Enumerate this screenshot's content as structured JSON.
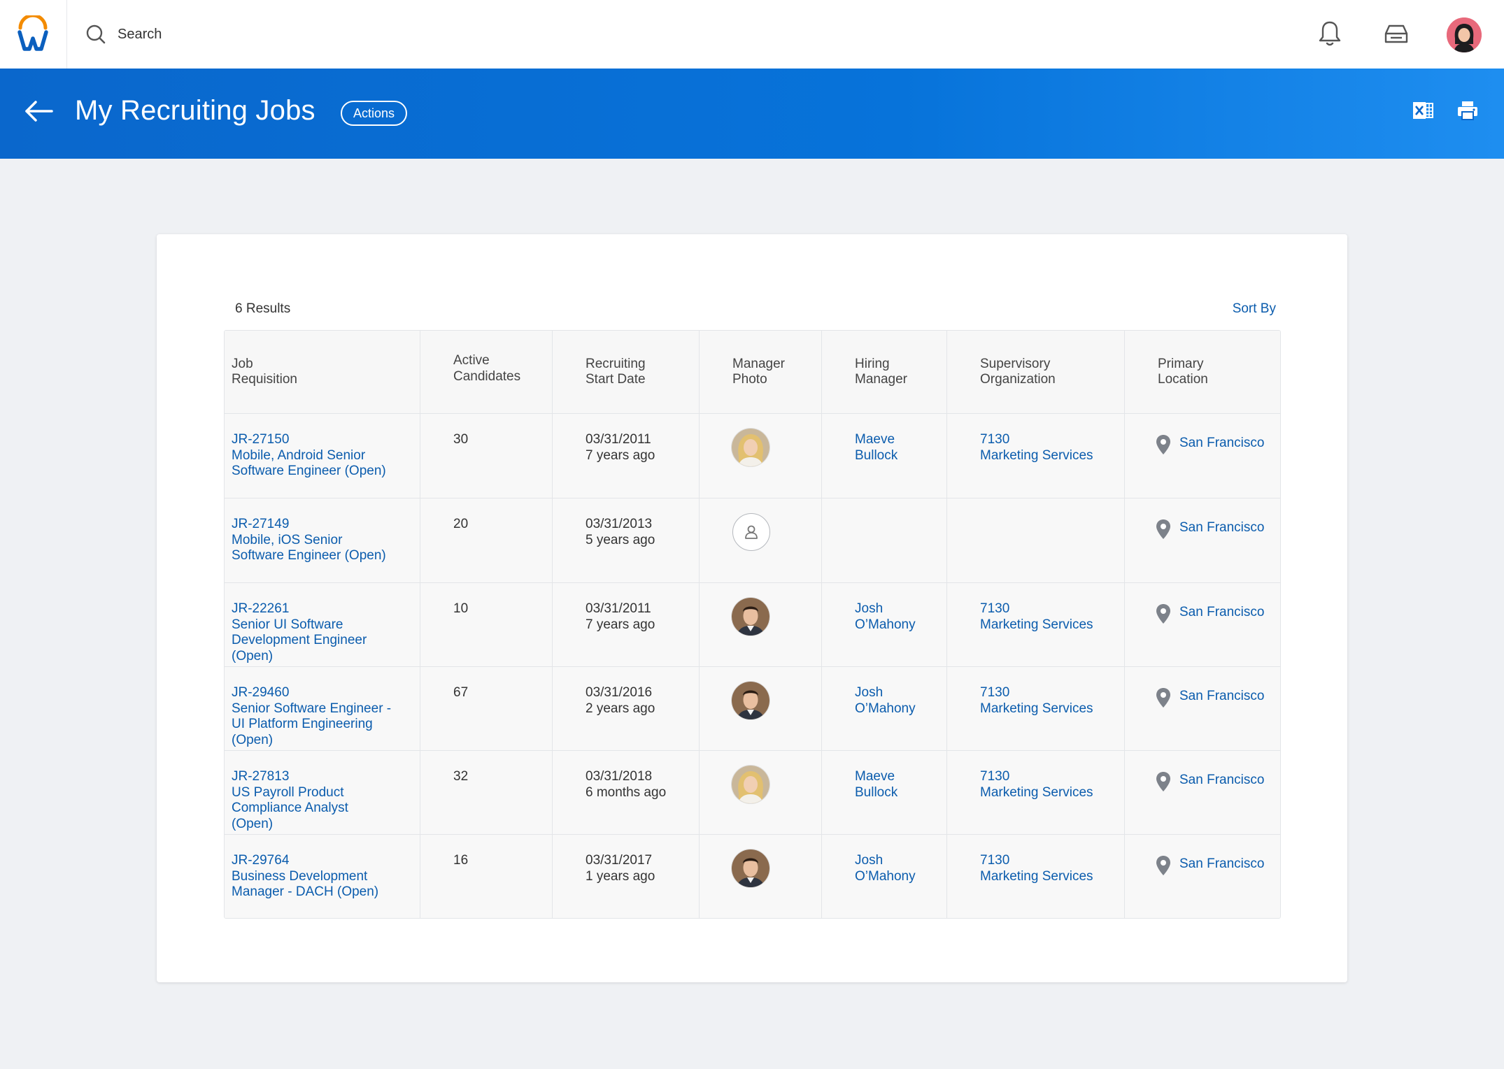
{
  "topbar": {
    "search_label": "Search"
  },
  "header": {
    "title": "My Recruiting Jobs",
    "actions_label": "Actions"
  },
  "card": {
    "results_label": "6 Results",
    "sort_label": "Sort By"
  },
  "table": {
    "columns": [
      "Job\nRequisition",
      "Active\nCandidates",
      "Recruiting\nStart Date",
      "Manager\nPhoto",
      "Hiring\nManager",
      "Supervisory\nOrganization",
      "Primary\nLocation"
    ],
    "rows": [
      {
        "req_id": "JR-27150",
        "req_title": "Mobile, Android Senior\nSoftware Engineer (Open)",
        "candidates": "30",
        "start_date": "03/31/2011",
        "start_ago": "7 years ago",
        "photo": "woman",
        "manager": "Maeve\nBullock",
        "org_code": "7130",
        "org_name": "Marketing Services",
        "location": "San Francisco"
      },
      {
        "req_id": "JR-27149",
        "req_title": "Mobile, iOS Senior\nSoftware Engineer (Open)",
        "candidates": "20",
        "start_date": "03/31/2013",
        "start_ago": "5 years ago",
        "photo": "placeholder",
        "manager": "",
        "org_code": "",
        "org_name": "",
        "location": "San Francisco"
      },
      {
        "req_id": "JR-22261",
        "req_title": "Senior UI Software\nDevelopment Engineer\n(Open)",
        "candidates": "10",
        "start_date": "03/31/2011",
        "start_ago": "7 years ago",
        "photo": "man",
        "manager": "Josh\nO’Mahony",
        "org_code": "7130",
        "org_name": "Marketing Services",
        "location": "San Francisco"
      },
      {
        "req_id": "JR-29460",
        "req_title": "Senior Software Engineer -\nUI Platform Engineering\n(Open)",
        "candidates": "67",
        "start_date": "03/31/2016",
        "start_ago": "2 years ago",
        "photo": "man",
        "manager": "Josh\nO’Mahony",
        "org_code": "7130",
        "org_name": "Marketing Services",
        "location": "San Francisco"
      },
      {
        "req_id": "JR-27813",
        "req_title": "US Payroll Product\nCompliance Analyst\n(Open)",
        "candidates": "32",
        "start_date": "03/31/2018",
        "start_ago": "6 months ago",
        "photo": "woman",
        "manager": "Maeve\nBullock",
        "org_code": "7130",
        "org_name": "Marketing Services",
        "location": "San Francisco"
      },
      {
        "req_id": "JR-29764",
        "req_title": "Business Development\nManager - DACH (Open)",
        "candidates": "16",
        "start_date": "03/31/2017",
        "start_ago": "1 years ago",
        "photo": "man",
        "manager": "Josh\nO’Mahony",
        "org_code": "7130",
        "org_name": "Marketing Services",
        "location": "San Francisco"
      }
    ]
  },
  "icons": {
    "logo": "workday-logo",
    "search": "search-icon",
    "notifications": "bell-icon",
    "inbox": "inbox-icon",
    "back": "back-arrow-icon",
    "excel": "excel-export-icon",
    "print": "print-icon",
    "location": "location-pin-icon"
  },
  "colors": {
    "brand_blue": "#0a67cc",
    "link": "#0b5cad",
    "logo_orange": "#f38b00"
  }
}
